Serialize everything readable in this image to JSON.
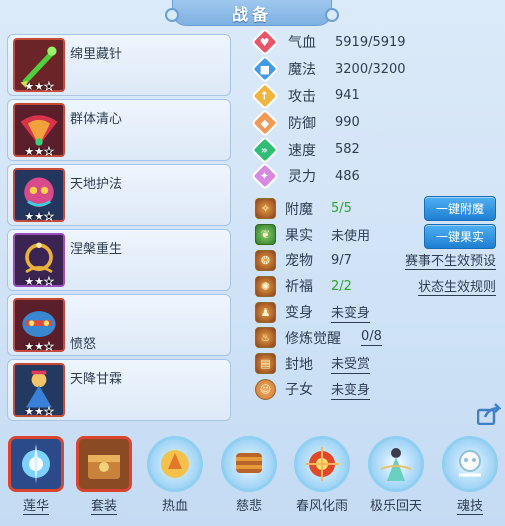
{
  "title": "战备",
  "skills": [
    {
      "name": "绵里藏针",
      "stars_filled": 2,
      "stars_total": 3,
      "icon": "green-blade-icon"
    },
    {
      "name": "群体清心",
      "stars_filled": 2,
      "stars_total": 3,
      "icon": "fan-spirit-icon"
    },
    {
      "name": "天地护法",
      "stars_filled": 2,
      "stars_total": 3,
      "icon": "guardian-mask-icon"
    },
    {
      "name": "涅槃重生",
      "stars_filled": 2,
      "stars_total": 3,
      "icon": "golden-ring-icon"
    },
    {
      "name": "愤怒",
      "stars_filled": 2,
      "stars_total": 3,
      "icon": "rage-mask-icon"
    },
    {
      "name": "天降甘霖",
      "stars_filled": 2,
      "stars_total": 3,
      "icon": "rain-deity-icon"
    }
  ],
  "stats": [
    {
      "label": "气血",
      "value": "5919/5919",
      "color": "#e9556b",
      "icon": "heart-icon"
    },
    {
      "label": "魔法",
      "value": "3200/3200",
      "color": "#3f9be8",
      "icon": "mana-icon"
    },
    {
      "label": "攻击",
      "value": "941",
      "color": "#f0b53e",
      "icon": "attack-icon"
    },
    {
      "label": "防御",
      "value": "990",
      "color": "#f09a55",
      "icon": "shield-icon"
    },
    {
      "label": "速度",
      "value": "582",
      "color": "#2fbf74",
      "icon": "speed-icon"
    },
    {
      "label": "灵力",
      "value": "486",
      "color": "#d78be0",
      "icon": "spirit-icon"
    }
  ],
  "extras": [
    {
      "label": "附魔",
      "value": "5/5",
      "style": "green",
      "icon": "enchant-icon"
    },
    {
      "label": "果实",
      "value": "未使用",
      "style": "plain",
      "icon": "fruit-icon"
    },
    {
      "label": "宠物",
      "value": "9/7",
      "style": "plain",
      "icon": "pet-icon"
    },
    {
      "label": "祈福",
      "value": "2/2",
      "style": "green",
      "icon": "blessing-icon"
    },
    {
      "label": "变身",
      "value": "未变身",
      "style": "under",
      "icon": "transform-icon"
    },
    {
      "label": "修炼觉醒",
      "value": "0/8",
      "style": "under",
      "icon": "cultivation-icon"
    },
    {
      "label": "封地",
      "value": "未受赏",
      "style": "under",
      "icon": "fief-icon"
    },
    {
      "label": "子女",
      "value": "未变身",
      "style": "under",
      "icon": "child-icon"
    }
  ],
  "buttons": {
    "enchant": "一键附魔",
    "fruit": "一键果实"
  },
  "links": {
    "preset": "赛事不生效预设",
    "rules": "状态生效规则"
  },
  "bottom": [
    {
      "label": "莲华",
      "icon": "lotus-orb-icon",
      "shape": "square",
      "underline": true
    },
    {
      "label": "套装",
      "icon": "treasure-chest-icon",
      "shape": "square",
      "underline": true
    },
    {
      "label": "热血",
      "icon": "hot-blood-icon",
      "shape": "circle",
      "underline": false
    },
    {
      "label": "慈悲",
      "icon": "mercy-scroll-icon",
      "shape": "circle",
      "underline": false
    },
    {
      "label": "春风化雨",
      "icon": "spring-rain-icon",
      "shape": "circle",
      "underline": false
    },
    {
      "label": "极乐回天",
      "icon": "bliss-revival-icon",
      "shape": "circle",
      "underline": false
    },
    {
      "label": "魂技",
      "icon": "soul-skill-icon",
      "shape": "circle",
      "underline": true
    }
  ]
}
